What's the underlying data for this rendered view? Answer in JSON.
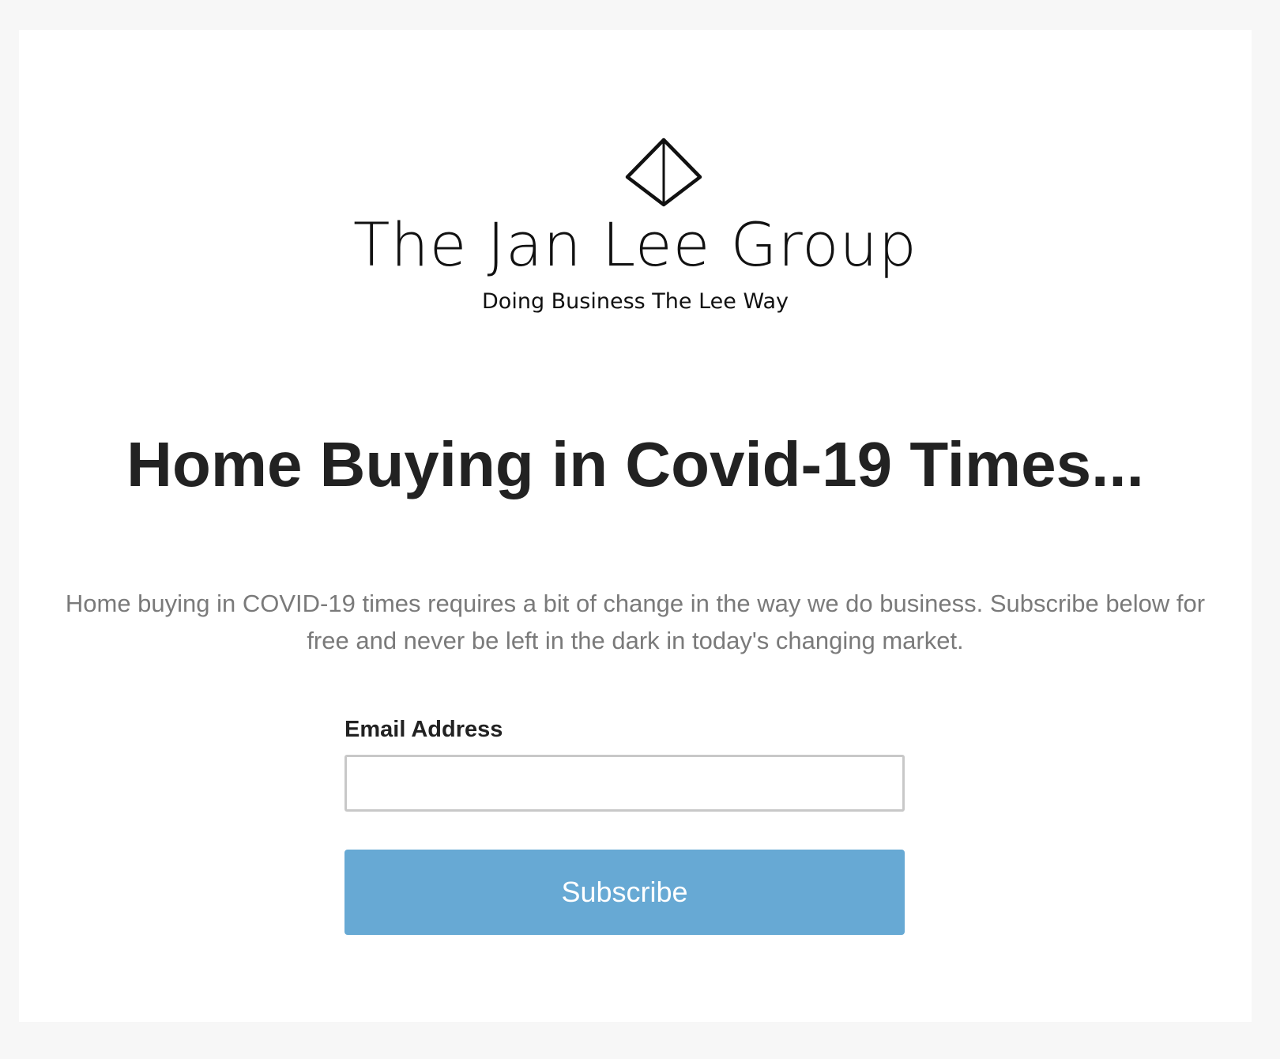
{
  "brand": {
    "name": "The Jan Lee Group",
    "tagline": "Doing Business The Lee Way",
    "logo_icon": "diamond-icon"
  },
  "headline": "Home Buying in Covid-19 Times...",
  "intro": "Home buying in COVID-19 times requires a bit of change in the way we do business. Subscribe below for free and never be left in the dark in today's changing market.",
  "form": {
    "email_label": "Email Address",
    "email_value": "",
    "email_placeholder": "",
    "subscribe_label": "Subscribe"
  },
  "colors": {
    "page_background": "#f7f7f7",
    "card_background": "#ffffff",
    "headline": "#222222",
    "intro_text": "#7a7a7a",
    "button": "#67a9d4",
    "button_text": "#ffffff"
  }
}
